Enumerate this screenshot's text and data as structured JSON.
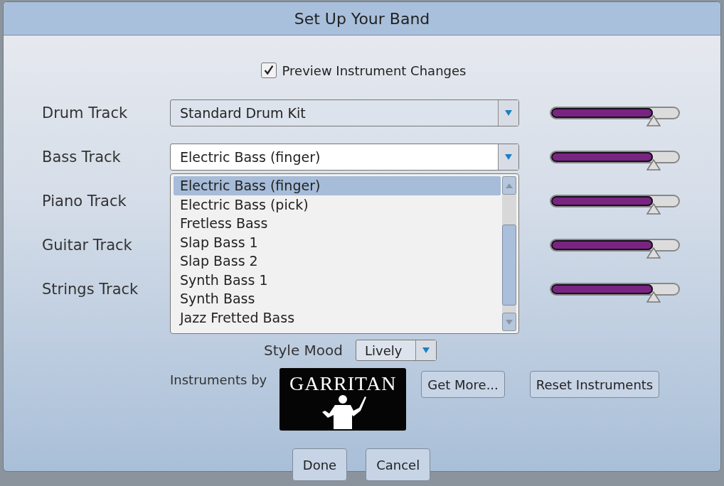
{
  "window": {
    "title": "Set Up Your Band"
  },
  "preview": {
    "label": "Preview Instrument Changes",
    "checked": true
  },
  "tracks": [
    {
      "label": "Drum Track",
      "instrument": "Standard Drum Kit",
      "expanded": false,
      "level": 0.8
    },
    {
      "label": "Bass Track",
      "instrument": "Electric Bass (finger)",
      "expanded": true,
      "level": 0.8
    },
    {
      "label": "Piano Track",
      "level": 0.8
    },
    {
      "label": "Guitar Track",
      "level": 0.8
    },
    {
      "label": "Strings Track",
      "level": 0.8
    }
  ],
  "instrument_list": [
    {
      "label": "Electric Bass (finger)",
      "selected": true
    },
    {
      "label": "Electric Bass (pick)",
      "selected": false
    },
    {
      "label": "Fretless Bass",
      "selected": false
    },
    {
      "label": "Slap Bass 1",
      "selected": false
    },
    {
      "label": "Slap Bass 2",
      "selected": false
    },
    {
      "label": "Synth Bass 1",
      "selected": false
    },
    {
      "label": "Synth Bass",
      "selected": false
    },
    {
      "label": "Jazz Fretted Bass",
      "selected": false
    }
  ],
  "style_mood": {
    "label": "Style Mood",
    "value": "Lively"
  },
  "credits": {
    "label": "Instruments by",
    "logo": "GARRITAN"
  },
  "buttons": [
    "Get More...",
    "Reset Instruments"
  ],
  "footer_buttons": [
    "Done",
    "Cancel"
  ]
}
